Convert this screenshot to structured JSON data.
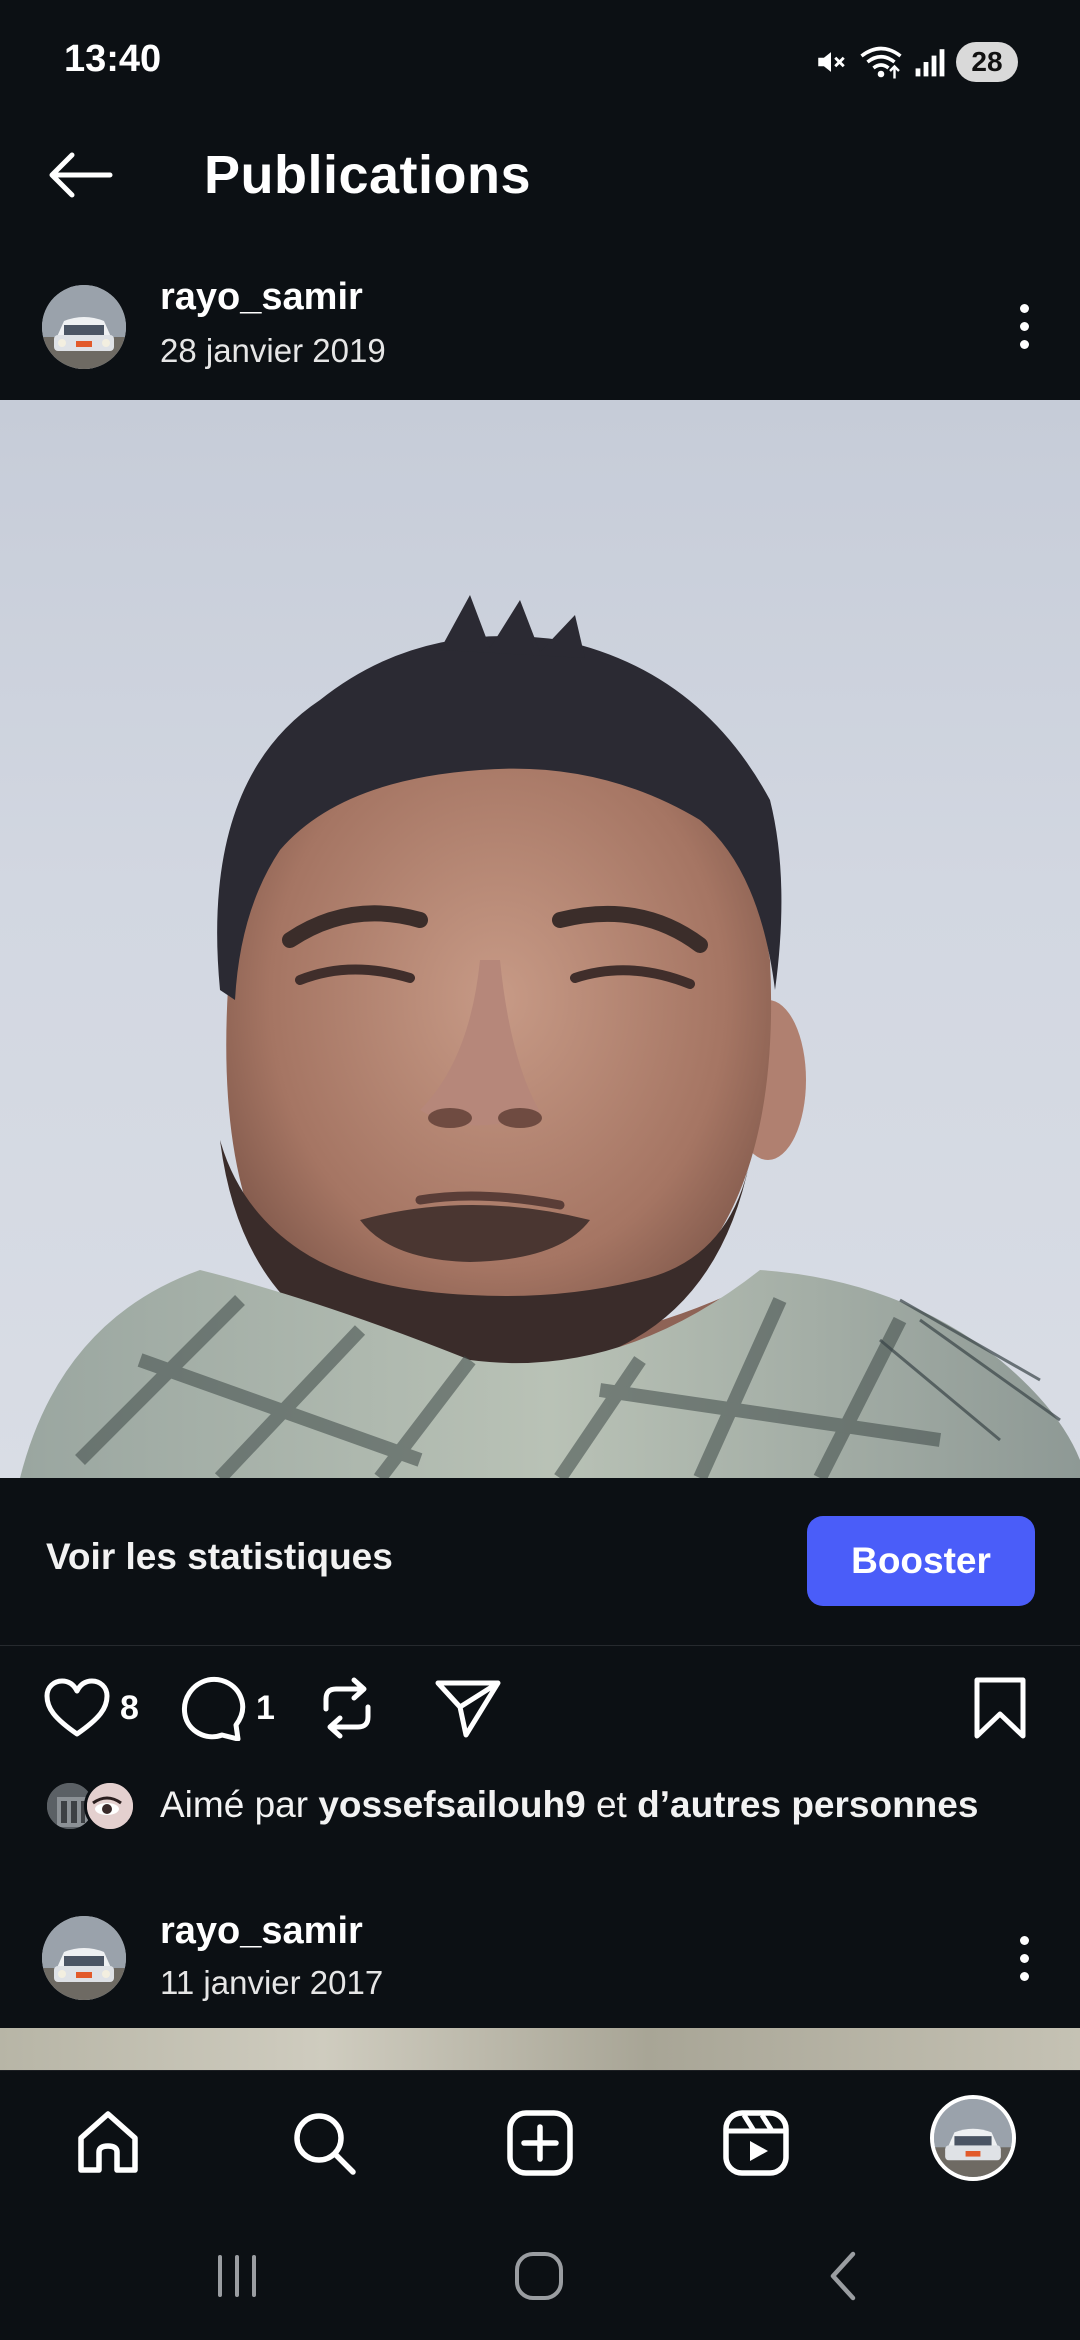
{
  "status_bar": {
    "time": "13:40",
    "battery": "28"
  },
  "header": {
    "title": "Publications"
  },
  "post1": {
    "username": "rayo_samir",
    "date": "28 janvier 2019"
  },
  "insights": {
    "stats_label": "Voir les statistiques",
    "boost_label": "Booster"
  },
  "actions": {
    "likes_count": "8",
    "comments_count": "1"
  },
  "likes": {
    "prefix": "Aimé par",
    "user": "yossefsailouh9",
    "connector": "et",
    "others": "d’autres personnes"
  },
  "post2": {
    "username": "rayo_samir",
    "date": "11 janvier 2017"
  },
  "colors": {
    "background": "#0c1014",
    "accent": "#4a5df9"
  },
  "icons": {
    "back": "arrow-left-icon",
    "more": "kebab-icon",
    "like": "heart-icon",
    "comment": "comment-icon",
    "repost": "repost-icon",
    "share": "send-icon",
    "save": "bookmark-icon",
    "nav": [
      "home-icon",
      "search-icon",
      "create-icon",
      "reels-icon",
      "profile-avatar"
    ]
  }
}
